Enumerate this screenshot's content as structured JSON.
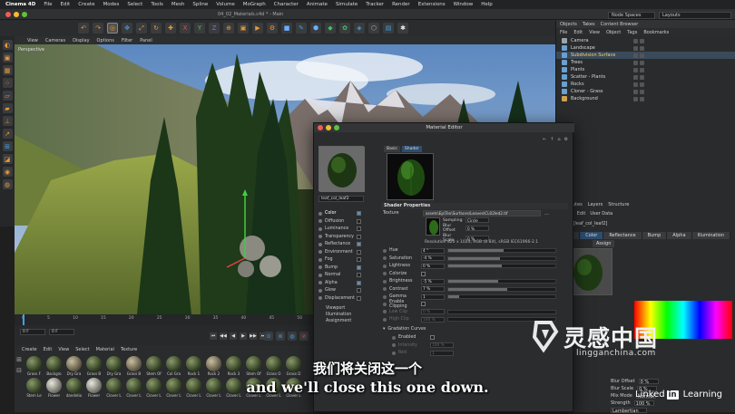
{
  "menubar": {
    "app": "Cinema 4D",
    "items": [
      "File",
      "Edit",
      "Create",
      "Modes",
      "Select",
      "Tools",
      "Mesh",
      "Spline",
      "Volume",
      "MoGraph",
      "Character",
      "Animate",
      "Simulate",
      "Tracker",
      "Render",
      "Extensions",
      "Window",
      "Help"
    ]
  },
  "window": {
    "title": "04_02_Materials.c4d * - Main",
    "node_spaces": "Node Spaces",
    "layouts": "Layouts"
  },
  "viewport": {
    "menu": [
      "View",
      "Cameras",
      "Display",
      "Options",
      "Filter",
      "Panel"
    ],
    "label": "Perspective",
    "camera_label": "Default"
  },
  "objects": {
    "tabs": [
      "Objects",
      "Takes",
      "Content Browser"
    ],
    "menu": [
      "File",
      "Edit",
      "View",
      "Object",
      "Tags",
      "Bookmarks"
    ],
    "items": [
      {
        "name": "Camera",
        "color": "#9aa4b0"
      },
      {
        "name": "Landscape",
        "color": "#6a9fd0"
      },
      {
        "name": "Subdivision Surface",
        "color": "#6a9fd0",
        "selected": true
      },
      {
        "name": "Trees",
        "color": "#6a9fd0"
      },
      {
        "name": "Plants",
        "color": "#6a9fd0"
      },
      {
        "name": "Scatter - Plants",
        "color": "#6a9fd0"
      },
      {
        "name": "Rocks",
        "color": "#6a9fd0"
      },
      {
        "name": "Cloner - Grass",
        "color": "#6a9fd0"
      },
      {
        "name": "Background",
        "color": "#d0a050"
      }
    ]
  },
  "attributes": {
    "tabs": [
      "Attributes",
      "Layers",
      "Structure"
    ],
    "menu": [
      "Mode",
      "Edit",
      "User Data"
    ],
    "material_name": "terial [leaf_col_leaf2]",
    "subtabs": [
      "Basic",
      "Color",
      "Reflectance",
      "Bump",
      "Alpha",
      "Illumination"
    ],
    "assign": "Assign",
    "blur_offset_label": "Blur Offset",
    "blur_offset": "0 %",
    "blur_scale_label": "Blur Scale",
    "blur_scale": "0 %",
    "mix_label": "Mix Mode",
    "mix": "Normal",
    "strength_label": "Strength",
    "strength": "100 %",
    "model": "Lambertian"
  },
  "timeline": {
    "ruler": [
      "0",
      "5",
      "10",
      "15",
      "20",
      "25",
      "30",
      "35",
      "40",
      "45",
      "50",
      "55"
    ],
    "start_frame": "0 F",
    "current_frame": "0 F",
    "transport": [
      "⏮",
      "◀◀",
      "◀",
      "▶",
      "▶▶",
      "⏭"
    ]
  },
  "material_manager": {
    "menu": [
      "Create",
      "Edit",
      "View",
      "Select",
      "Material",
      "Texture"
    ],
    "materials": [
      "Grass F",
      "Backgro",
      "Dry Gra",
      "Grass B",
      "Dry Gra",
      "Grass B",
      "Stem Of",
      "Col Gra",
      "Rock 1",
      "Rock 2",
      "Rock 3",
      "Stem Of",
      "Grass O",
      "Grass D",
      "Stem Le",
      "Flower",
      "dandelio",
      "Flower",
      "Clover L",
      "Clover L",
      "Clover L",
      "Clover L",
      "Clover L",
      "Clover L",
      "Clover L",
      "Clover L",
      "Clover L",
      "Clover L"
    ]
  },
  "material_editor": {
    "title": "Material Editor",
    "material_name": "leaf_col_leaf2",
    "tabs": [
      "Basic",
      "Shader"
    ],
    "channels": [
      {
        "name": "Color",
        "checked": true,
        "active": true
      },
      {
        "name": "Diffusion",
        "checked": false
      },
      {
        "name": "Luminance",
        "checked": false
      },
      {
        "name": "Transparency",
        "checked": false
      },
      {
        "name": "Reflectance",
        "checked": true
      },
      {
        "name": "Environment",
        "checked": false
      },
      {
        "name": "Fog",
        "checked": false
      },
      {
        "name": "Bump",
        "checked": true
      },
      {
        "name": "Normal",
        "checked": false
      },
      {
        "name": "Alpha",
        "checked": true
      },
      {
        "name": "Glow",
        "checked": false
      },
      {
        "name": "Displacement",
        "checked": false
      }
    ],
    "extra_channels": [
      "Viewport",
      "Illumination",
      "Assignment"
    ],
    "shader_properties": "Shader Properties",
    "texture_label": "Texture",
    "texture_path": "assets\\Ep\\Tex\\Surfaces\\Leaves\\CL02led2.tif",
    "sampling_label": "Sampling",
    "sampling": "Circle",
    "blur_offset_label": "Blur Offset",
    "blur_offset": "0 %",
    "blur_scale_label": "Blur Scale",
    "blur_scale": "0 %",
    "resolution": "Resolution 820 x 1024, RGB (8 Bit), sRGB IEC61966-2.1",
    "params": [
      {
        "name": "Hue",
        "value": "4 °",
        "fill": 0.52
      },
      {
        "name": "Saturation",
        "value": "-4 %",
        "fill": 0.48
      },
      {
        "name": "Lightness",
        "value": "0 %",
        "fill": 0.5
      },
      {
        "name": "Colorize",
        "value": "",
        "checkbox": true
      },
      {
        "name": "Brightness",
        "value": "-5 %",
        "fill": 0.47
      },
      {
        "name": "Contrast",
        "value": "7 %",
        "fill": 0.55
      },
      {
        "name": "Gamma",
        "value": "1",
        "fill": 0.1
      },
      {
        "name": "Enable Clipping",
        "value": "",
        "checkbox": true
      },
      {
        "name": "Low Clip",
        "value": "0 %",
        "dim": true,
        "fill": 0
      },
      {
        "name": "High Clip",
        "value": "100 %",
        "dim": true,
        "fill": 0
      }
    ],
    "gradient_curve": "Gradation Curves",
    "curve_rows": [
      {
        "name": "Enabled",
        "value": "",
        "checkbox": true
      },
      {
        "name": "Intensity",
        "value": "100 %",
        "dim": true
      },
      {
        "name": "Red",
        "value": "1",
        "dim": true
      }
    ]
  },
  "overlay": {
    "subtitle_cn": "我们将关闭这一个",
    "subtitle_en": "and we'll close this one down.",
    "brand_cn": "灵感中国",
    "brand_url": "lingganchina.com",
    "linkedin_text": "Linked",
    "linkedin_in": "in",
    "linkedin_learning": "Learning"
  }
}
